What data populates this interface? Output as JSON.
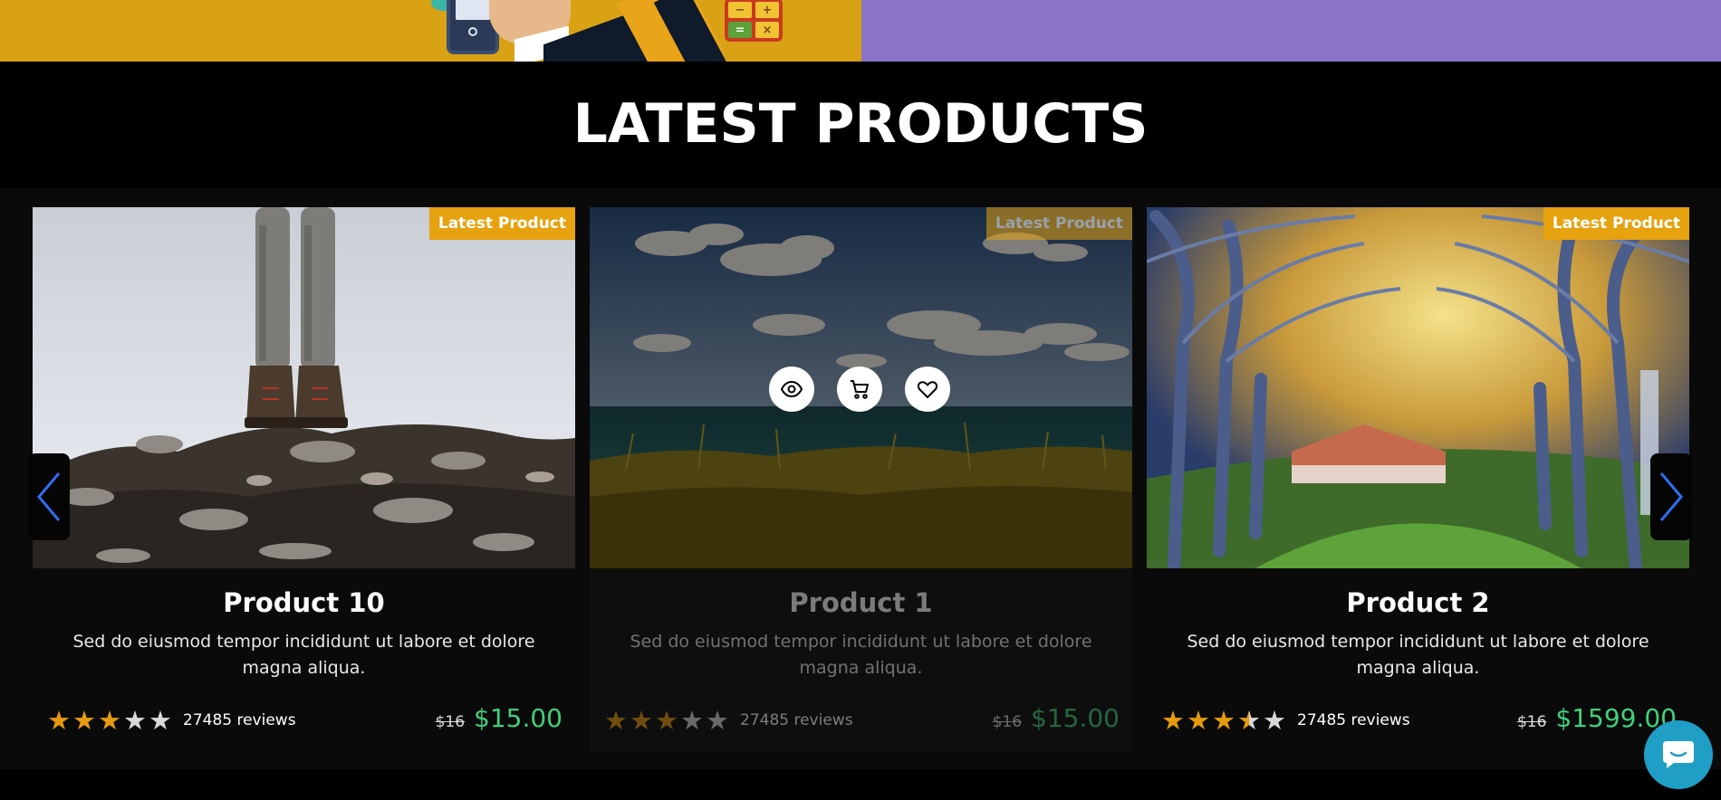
{
  "section": {
    "title": "LATEST PRODUCTS"
  },
  "products": [
    {
      "badge": "Latest Product",
      "title": "Product 10",
      "description": "Sed do eiusmod tempor incididunt ut labore et dolore magna aliqua.",
      "rating": 3,
      "reviews": "27485 reviews",
      "old_price": "$16",
      "price": "$15.00"
    },
    {
      "badge": "Latest Product",
      "title": "Product 1",
      "description": "Sed do eiusmod tempor incididunt ut labore et dolore magna aliqua.",
      "rating": 3,
      "reviews": "27485 reviews",
      "old_price": "$16",
      "price": "$15.00"
    },
    {
      "badge": "Latest Product",
      "title": "Product 2",
      "description": "Sed do eiusmod tempor incididunt ut labore et dolore magna aliqua.",
      "rating": 3.5,
      "reviews": "27485 reviews",
      "old_price": "$16",
      "price": "$1599.00"
    }
  ],
  "banner": {
    "calc_keys": [
      "−",
      "+",
      "=",
      "×"
    ]
  },
  "colors": {
    "accent": "#e6a20f",
    "price": "#3fd07a",
    "star": "#e69a0f",
    "arrow": "#2f6ef0",
    "chat": "#1f9ec6"
  },
  "icons": {
    "quick_view": "eye-icon",
    "add_to_cart": "cart-icon",
    "wishlist": "heart-icon",
    "prev": "chevron-left-icon",
    "next": "chevron-right-icon",
    "chat": "chat-icon"
  }
}
